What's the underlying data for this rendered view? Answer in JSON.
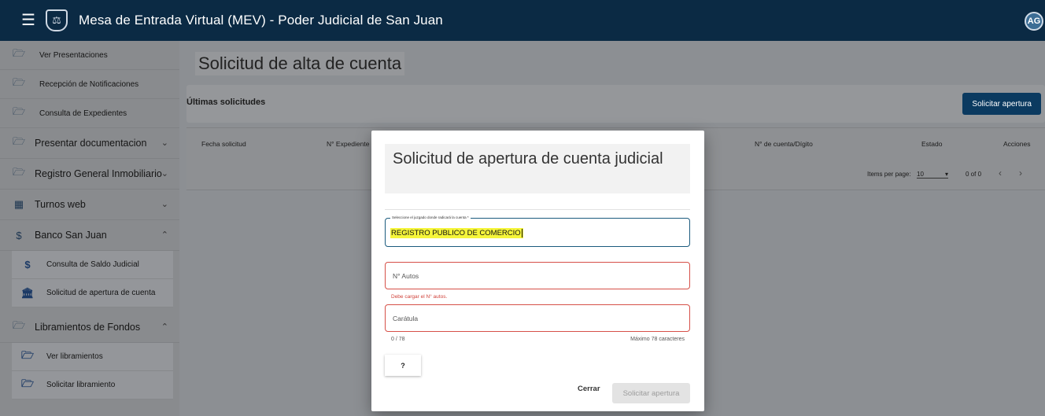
{
  "app": {
    "title": "Mesa de Entrada Virtual (MEV) - Poder Judicial de San Juan",
    "avatar_initials": "AG",
    "menu_icon": "hamburger-icon",
    "logo_icon": "judicial-shield-logo"
  },
  "sidebar": {
    "items": [
      {
        "label": "Ver Presentaciones",
        "icon": "folder-icon"
      },
      {
        "label": "Recepción de Notificaciones",
        "icon": "folder-icon"
      },
      {
        "label": "Consulta de Expedientes",
        "icon": "folder-icon"
      },
      {
        "label": "Presentar documentacion",
        "icon": "folder-icon",
        "state": "collapsed"
      },
      {
        "label": "Registro General Inmobiliario",
        "icon": "folder-icon",
        "state": "collapsed"
      },
      {
        "label": "Turnos web",
        "icon": "calendar-icon",
        "state": "collapsed"
      },
      {
        "label": "Banco San Juan",
        "icon": "dollar-icon",
        "state": "expanded"
      },
      {
        "label": "Consulta de Saldo Judicial",
        "icon": "dollar-icon"
      },
      {
        "label": "Solicitud de apertura de cuenta",
        "icon": "bank-icon"
      },
      {
        "label": "Libramientos de Fondos",
        "icon": "folder-icon",
        "state": "expanded"
      },
      {
        "label": "Ver libramientos",
        "icon": "folder-icon"
      },
      {
        "label": "Solicitar libramiento",
        "icon": "folder-icon"
      }
    ]
  },
  "main": {
    "title": "Solicitud de alta de cuenta",
    "card_title": "Últimas solicitudes",
    "open_button": "Solicitar apertura",
    "table": {
      "headers": [
        "Fecha solicitud",
        "N° Expediente",
        "N° de cuenta/Dígito",
        "Estado",
        "Acciones"
      ]
    },
    "paginator": {
      "items_per_page_label": "Items per page:",
      "page_size": "10",
      "range": "0 of 0"
    }
  },
  "dialog": {
    "title": "Solicitud de apertura de cuenta judicial",
    "court_field": {
      "label": "Seleccione el juzgado donde radicará la cuenta *",
      "value": "REGISTRO PUBLICO DE COMERCIO"
    },
    "autos_field": {
      "placeholder": "N° Autos",
      "error": "Debe cargar el N° autos."
    },
    "caratula_field": {
      "placeholder": "Carátula",
      "counter": "0 / 78",
      "hint": "Máximo 78 caracteres"
    },
    "help_button": "?",
    "close_button": "Cerrar",
    "submit_button": "Solicitar apertura"
  },
  "colors": {
    "topbar": "#0b2a44",
    "primary_button": "#0b3a60",
    "error": "#d65048",
    "focus_border": "#1b5b7e",
    "highlight": "#f5f53a"
  }
}
